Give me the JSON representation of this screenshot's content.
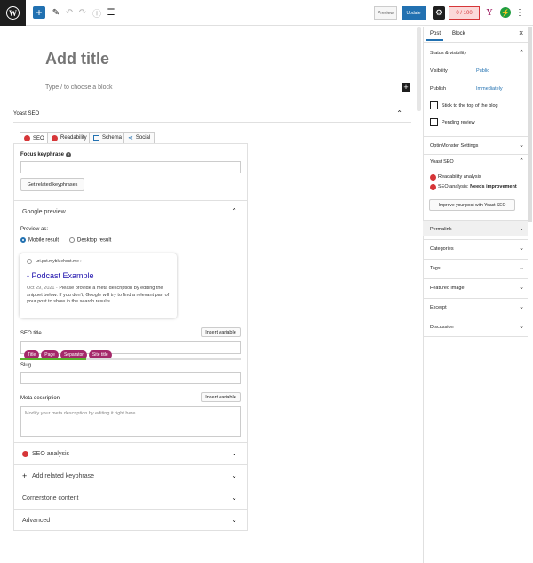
{
  "toolbar": {
    "add_icon": "plus-icon",
    "preview_label": "Preview",
    "update_label": "Update",
    "seo_score": "0 / 100",
    "more_icon": "vertical-dots-icon"
  },
  "editor": {
    "title_placeholder": "Add title",
    "block_placeholder": "Type / to choose a block"
  },
  "yoast": {
    "panel_title": "Yoast SEO",
    "tabs": [
      {
        "label": "SEO"
      },
      {
        "label": "Readability"
      },
      {
        "label": "Schema"
      },
      {
        "label": "Social"
      }
    ],
    "focus_keyphrase_label": "Focus keyphrase",
    "related_button": "Get related keyphrases",
    "google_preview": {
      "title": "Google preview",
      "preview_as": "Preview as:",
      "mobile": "Mobile result",
      "desktop": "Desktop result",
      "url": "uri.pct.mybluehost.me ›",
      "page_title": "- Podcast Example",
      "date": "Oct 29, 2021",
      "snippet": "· Please provide a meta description by editing the snippet below. If you don’t, Google will try to find a relevant part of your post to show in the search results."
    },
    "seo_title_label": "SEO title",
    "insert_variable": "Insert variable",
    "seo_title_pills": [
      "Title",
      "Page",
      "Separator",
      "Site title"
    ],
    "seo_title_progress": 0.3,
    "slug_label": "Slug",
    "meta_label": "Meta description",
    "meta_placeholder": "Modify your meta description by editing it right here",
    "sections": [
      {
        "label": "SEO analysis"
      },
      {
        "label": "Add related keyphrase"
      },
      {
        "label": "Cornerstone content"
      },
      {
        "label": "Advanced"
      }
    ]
  },
  "sidebar": {
    "tab_post": "Post",
    "tab_block": "Block",
    "status_title": "Status & visibility",
    "visibility_label": "Visibility",
    "visibility_value": "Public",
    "publish_label": "Publish",
    "publish_value": "Immediately",
    "stick_label": "Stick to the top of the blog",
    "pending_label": "Pending review",
    "optin_title": "OptinMonster Settings",
    "yoast_title": "Yoast SEO",
    "readability_label": "Readability analysis",
    "seo_analysis_prefix": "SEO analysis:",
    "seo_analysis_value": "Needs improvement",
    "improve_button": "Improve your post with Yoast SEO",
    "panels": [
      "Permalink",
      "Categories",
      "Tags",
      "Featured image",
      "Excerpt",
      "Discussion"
    ]
  },
  "colors": {
    "accent": "#2271b1",
    "yoast_purple": "#a4286a",
    "bad_red": "#d63638",
    "good_green": "#5bb12f"
  }
}
